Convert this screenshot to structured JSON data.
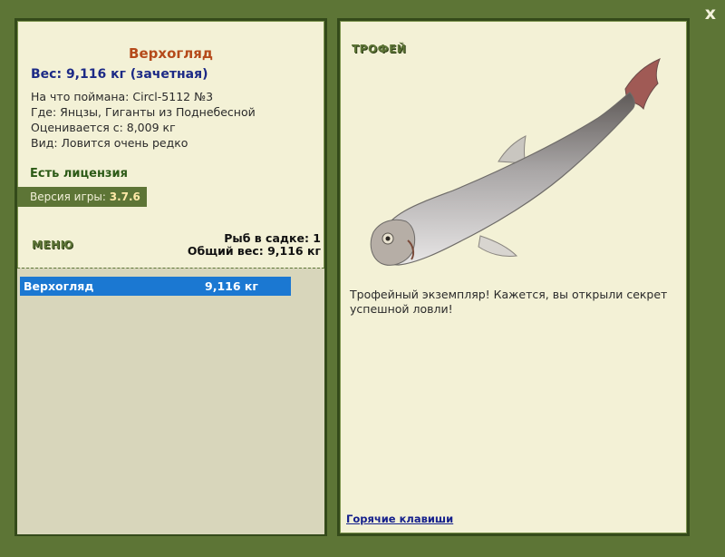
{
  "close_label": "x",
  "fish": {
    "name": "Верхогляд",
    "weight_line": "Вес: 9,116 кг (зачетная)",
    "caught_on": "На что поймана: Circl-5112 №3",
    "where": "Где: Янцзы, Гиганты из Поднебесной",
    "valued_from": "Оценивается с: 8,009 кг",
    "rarity": "Вид: Ловится очень редко"
  },
  "license": "Есть лицензия",
  "version": {
    "label": "Версия игры:",
    "value": "3.7.6"
  },
  "menu_label": "МЕНЮ",
  "keepnet": {
    "count_line": "Рыб в садке: 1",
    "total_line": "Общий вес: 9,116 кг",
    "items": [
      {
        "name": "Верхогляд",
        "weight": "9,116 кг"
      }
    ]
  },
  "trophy": {
    "label": "ТРОФЕЙ",
    "text": "Трофейный экземпляр! Кажется, вы открыли секрет успешной ловли!"
  },
  "hotkeys_link": "Горячие клавиши",
  "colors": {
    "frame": "#5d7536",
    "panel": "#f3f1d6",
    "title": "#b54a1a",
    "weight": "#1c2a86",
    "selected_row": "#1b78d2"
  }
}
